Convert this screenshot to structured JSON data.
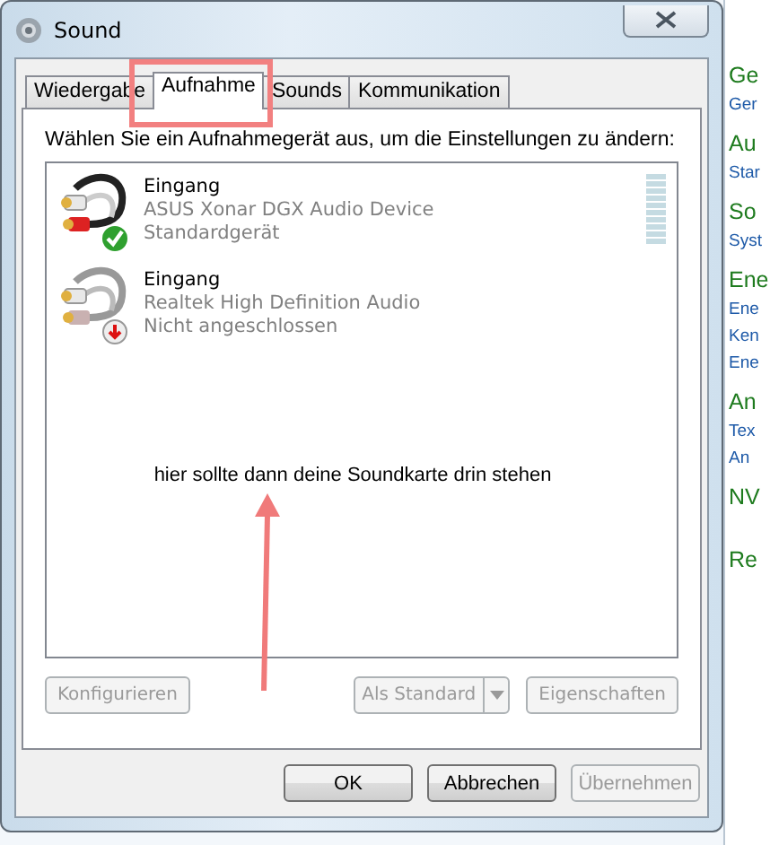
{
  "window": {
    "title": "Sound"
  },
  "tabs": [
    {
      "label": "Wiedergabe",
      "selected": false
    },
    {
      "label": "Aufnahme",
      "selected": true
    },
    {
      "label": "Sounds",
      "selected": false
    },
    {
      "label": "Kommunikation",
      "selected": false
    }
  ],
  "instruction": "Wählen Sie ein Aufnahmegerät aus, um die Einstellungen zu ändern:",
  "devices": [
    {
      "name": "Eingang",
      "description": "ASUS Xonar DGX Audio Device",
      "status_text": "Standardgerät",
      "default": true,
      "connected": true,
      "level": 0
    },
    {
      "name": "Eingang",
      "description": "Realtek High Definition Audio",
      "status_text": "Nicht angeschlossen",
      "default": false,
      "connected": false
    }
  ],
  "annotation": {
    "text": "hier sollte dann deine Soundkarte drin stehen"
  },
  "device_buttons": [
    {
      "label": "Konfigurieren",
      "disabled": true,
      "kind": "plain"
    },
    {
      "label": "Als Standard",
      "disabled": true,
      "kind": "split"
    },
    {
      "label": "Eigenschaften",
      "disabled": true,
      "kind": "plain"
    }
  ],
  "dialog_buttons": [
    {
      "label": "OK",
      "disabled": false
    },
    {
      "label": "Abbrechen",
      "disabled": false
    },
    {
      "label": "Übernehmen",
      "disabled": true
    }
  ],
  "background_panel": [
    {
      "text": "Ge",
      "kind": "heading"
    },
    {
      "text": "Ger",
      "kind": "link"
    },
    {
      "text": "Au",
      "kind": "heading"
    },
    {
      "text": "Star",
      "kind": "link"
    },
    {
      "text": "So",
      "kind": "heading"
    },
    {
      "text": "Syst",
      "kind": "link"
    },
    {
      "text": "Ene",
      "kind": "heading"
    },
    {
      "text": "Ene",
      "kind": "link"
    },
    {
      "text": "Ken",
      "kind": "link"
    },
    {
      "text": "Ene",
      "kind": "link"
    },
    {
      "text": "An",
      "kind": "heading"
    },
    {
      "text": "Tex",
      "kind": "link"
    },
    {
      "text": "An",
      "kind": "link"
    },
    {
      "text": "NV",
      "kind": "heading"
    },
    {
      "text": "Re",
      "kind": "heading"
    }
  ]
}
